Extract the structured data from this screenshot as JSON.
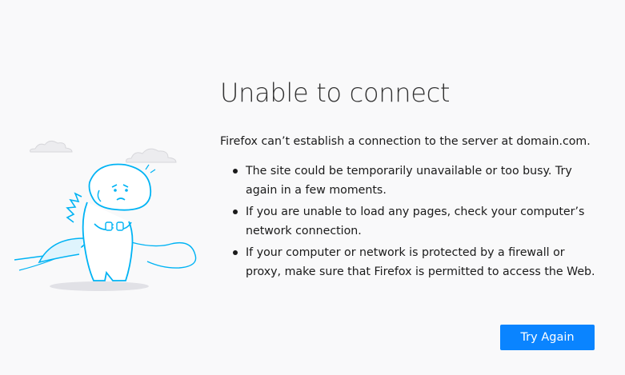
{
  "error_page": {
    "title": "Unable to connect",
    "intro": "Firefox can’t establish a connection to the server at domain.com.",
    "reasons": [
      "The site could be temporarily unavailable or too busy. Try again in a few moments.",
      "If you are unable to load any pages, check your computer’s network connection.",
      "If your computer or network is protected by a firewall or proxy, make sure that Firefox is permitted to access the Web."
    ],
    "try_again_label": "Try Again"
  },
  "colors": {
    "background": "#f9f9fa",
    "button": "#0a84ff",
    "illustration_stroke": "#00b3f4",
    "illustration_fill": "#ffffff"
  },
  "icons": {
    "illustration": "dinosaur-unplugged-cable-icon"
  }
}
